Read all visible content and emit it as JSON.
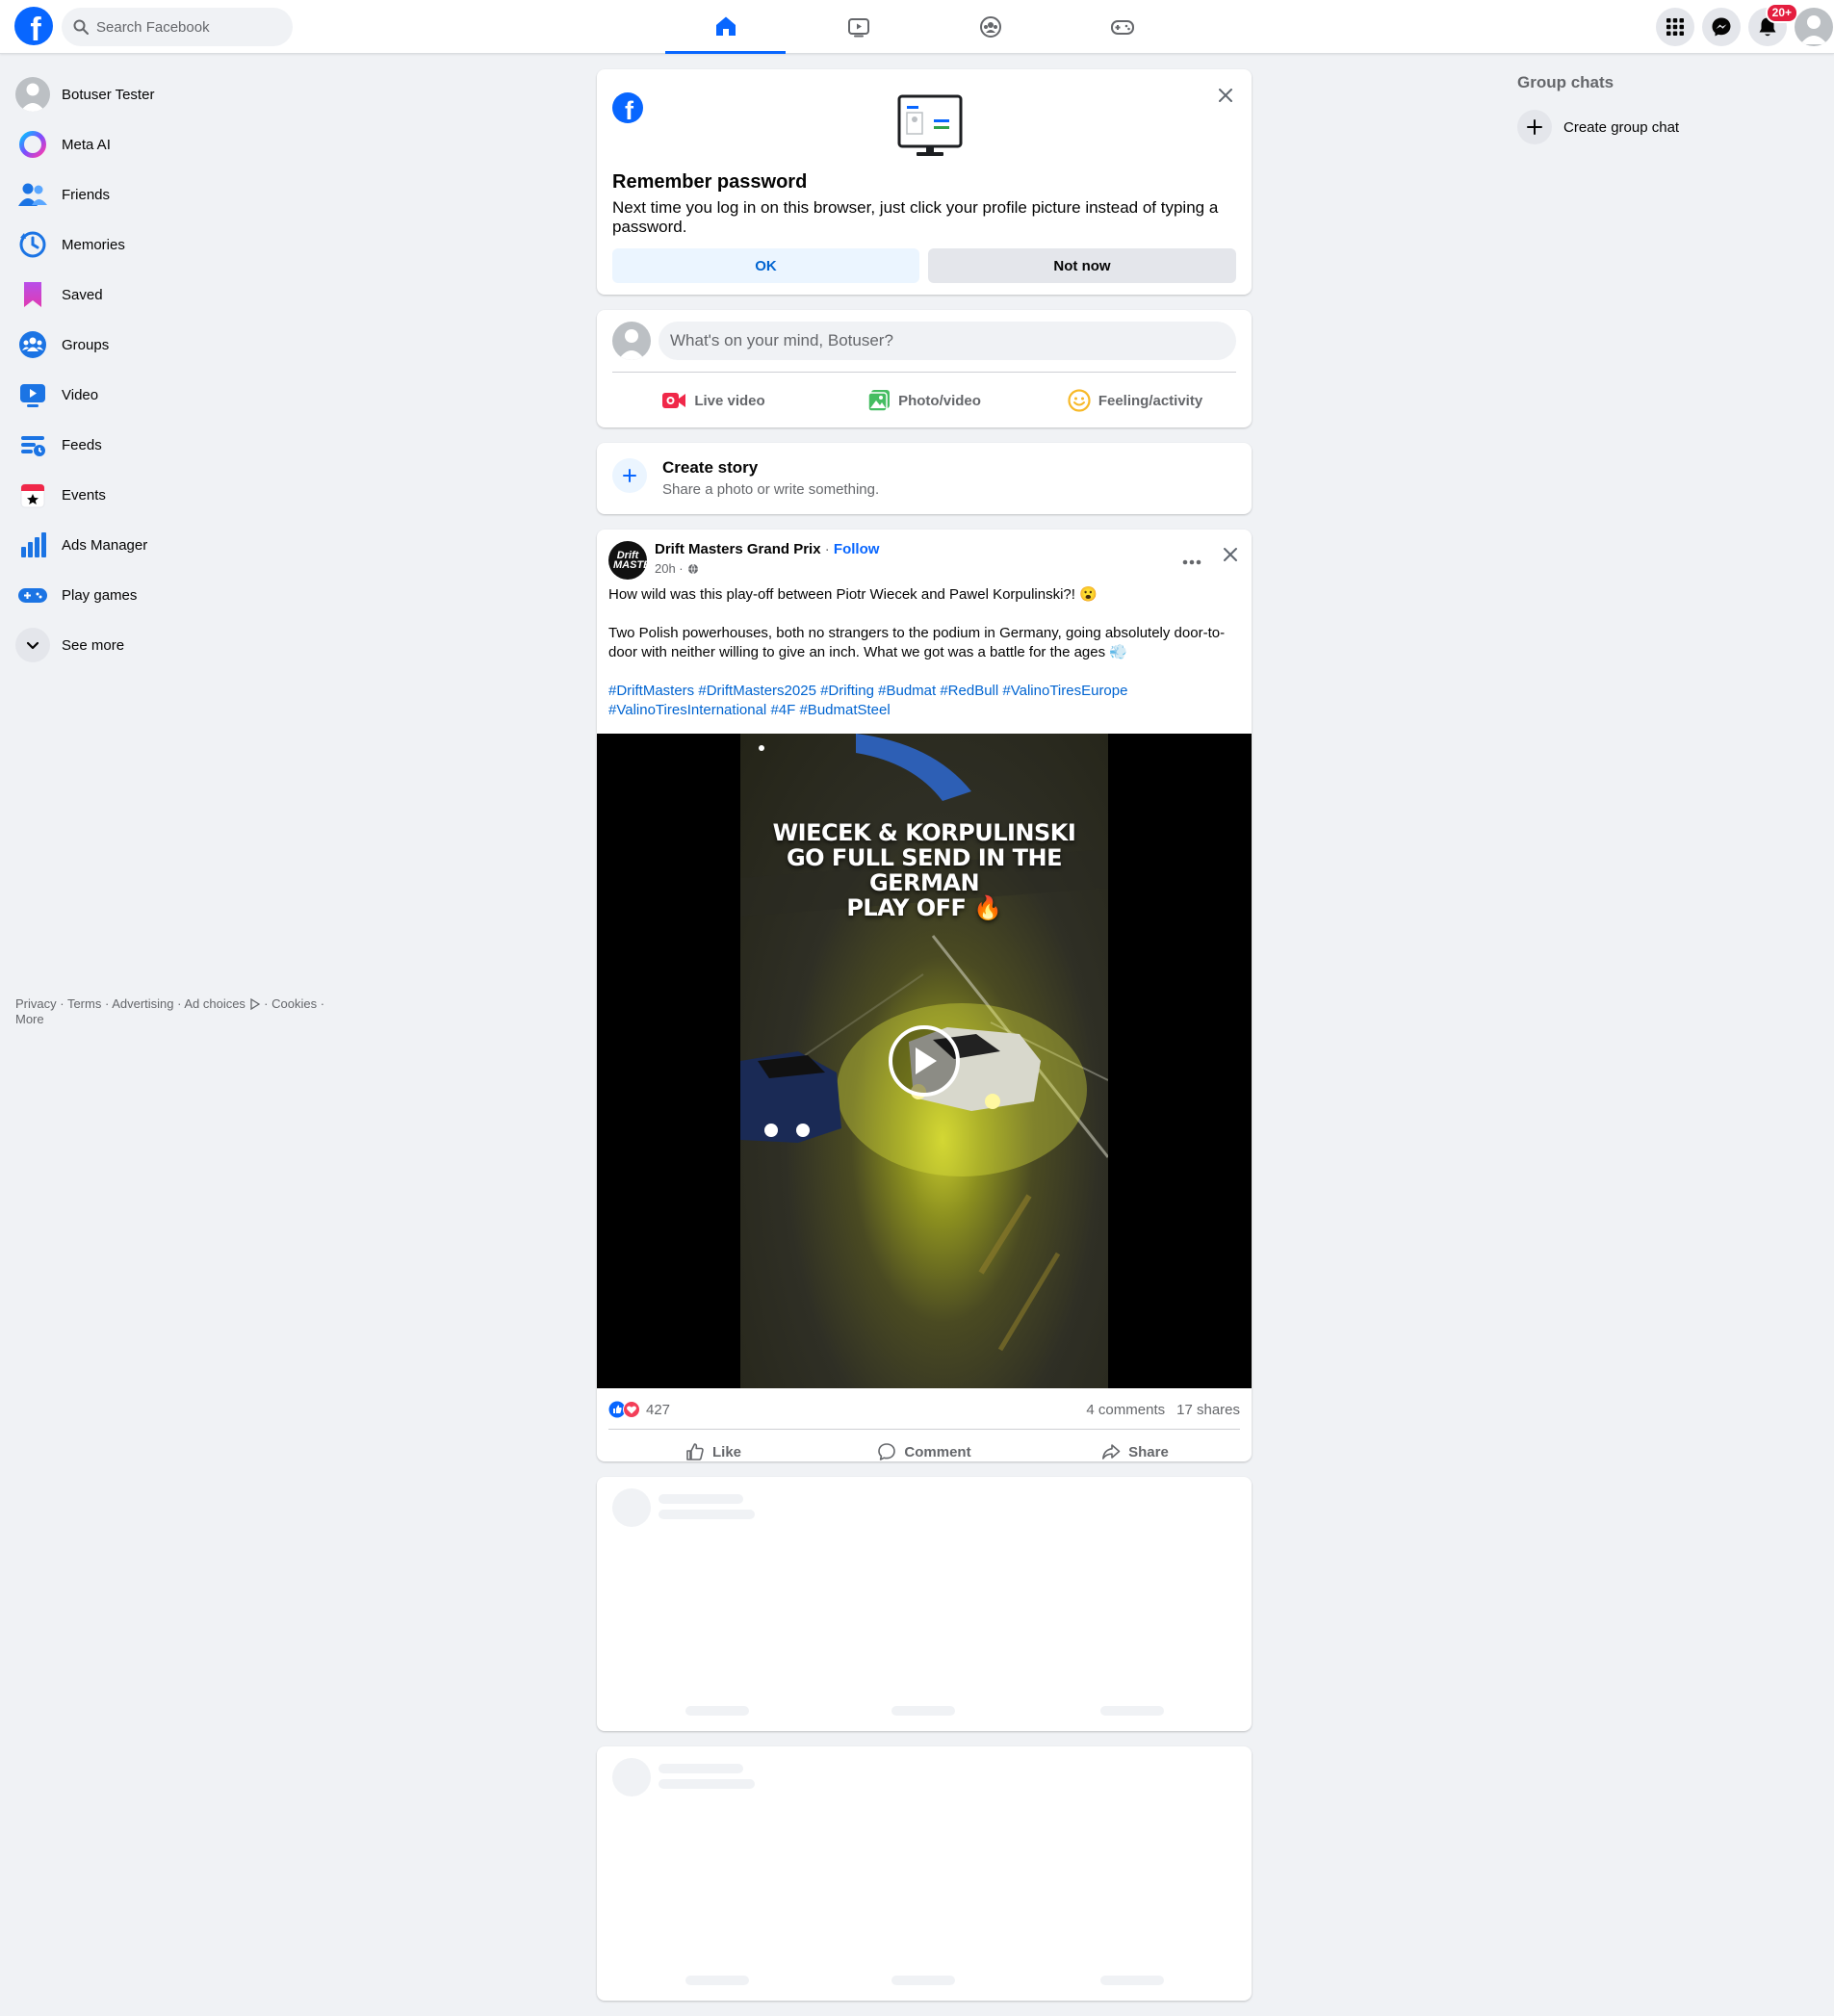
{
  "topbar": {
    "logo_glyph": "f",
    "search_placeholder": "Search Facebook",
    "nav_tabs": [
      {
        "name": "home",
        "icon": "home-icon",
        "active": true
      },
      {
        "name": "video",
        "icon": "video-icon",
        "active": false
      },
      {
        "name": "groups",
        "icon": "groups-icon",
        "active": false
      },
      {
        "name": "gaming",
        "icon": "gaming-icon",
        "active": false
      }
    ],
    "notifications_badge": "20+"
  },
  "sidebar": {
    "items": [
      {
        "label": "Botuser Tester",
        "icon": "profile-avatar-icon"
      },
      {
        "label": "Meta AI",
        "icon": "meta-ai-icon"
      },
      {
        "label": "Friends",
        "icon": "friends-icon"
      },
      {
        "label": "Memories",
        "icon": "memories-icon"
      },
      {
        "label": "Saved",
        "icon": "saved-icon"
      },
      {
        "label": "Groups",
        "icon": "groups-icon"
      },
      {
        "label": "Video",
        "icon": "video-icon"
      },
      {
        "label": "Feeds",
        "icon": "feeds-icon"
      },
      {
        "label": "Events",
        "icon": "events-icon"
      },
      {
        "label": "Ads Manager",
        "icon": "ads-manager-icon"
      },
      {
        "label": "Play games",
        "icon": "play-games-icon"
      },
      {
        "label": "See more",
        "icon": "chevron-down-icon"
      }
    ],
    "footer": {
      "privacy": "Privacy",
      "terms": "Terms",
      "advertising": "Advertising",
      "ad_choices": "Ad choices",
      "cookies": "Cookies",
      "more": "More"
    }
  },
  "right_column": {
    "heading": "Group chats",
    "create_label": "Create group chat"
  },
  "remember_password": {
    "title": "Remember password",
    "body": "Next time you log in on this browser, just click your profile picture instead of typing a password.",
    "ok_label": "OK",
    "not_now_label": "Not now"
  },
  "composer": {
    "placeholder": "What's on your mind, Botuser?",
    "live_label": "Live video",
    "photo_label": "Photo/video",
    "feeling_label": "Feeling/activity"
  },
  "story": {
    "title": "Create story",
    "subtitle": "Share a photo or write something."
  },
  "post": {
    "avatar_text": "Drift MASTERS",
    "author": "Drift Masters Grand Prix",
    "separator": " · ",
    "follow_label": "Follow",
    "time": "20h ·",
    "paragraph1": "How wild was this play-off between Piotr Wiecek and Pawel Korpulinski?! 😮",
    "paragraph2": "Two Polish powerhouses, both no strangers to the podium in Germany, going absolutely door-to-door with neither willing to give an inch. What we got was a battle for the ages 💨",
    "hashtags": [
      "#DriftMasters",
      "#DriftMasters2025",
      "#Drifting",
      "#Budmat",
      "#RedBull",
      "#ValinoTiresEurope",
      "#ValinoTiresInternational",
      "#4F",
      "#BudmatSteel"
    ],
    "video_caption_line1": "WIECEK & KORPULINSKI",
    "video_caption_line2": "GO FULL SEND IN THE GERMAN",
    "video_caption_line3": "PLAY OFF 🔥",
    "reactions_count": "427",
    "comments": "4 comments",
    "shares": "17 shares",
    "like_label": "Like",
    "comment_label": "Comment",
    "share_label": "Share"
  },
  "colors": {
    "brand_blue": "#0866ff",
    "page_bg": "#f0f2f5",
    "badge_red": "#e41e3f",
    "link_blue": "#0064d1"
  }
}
